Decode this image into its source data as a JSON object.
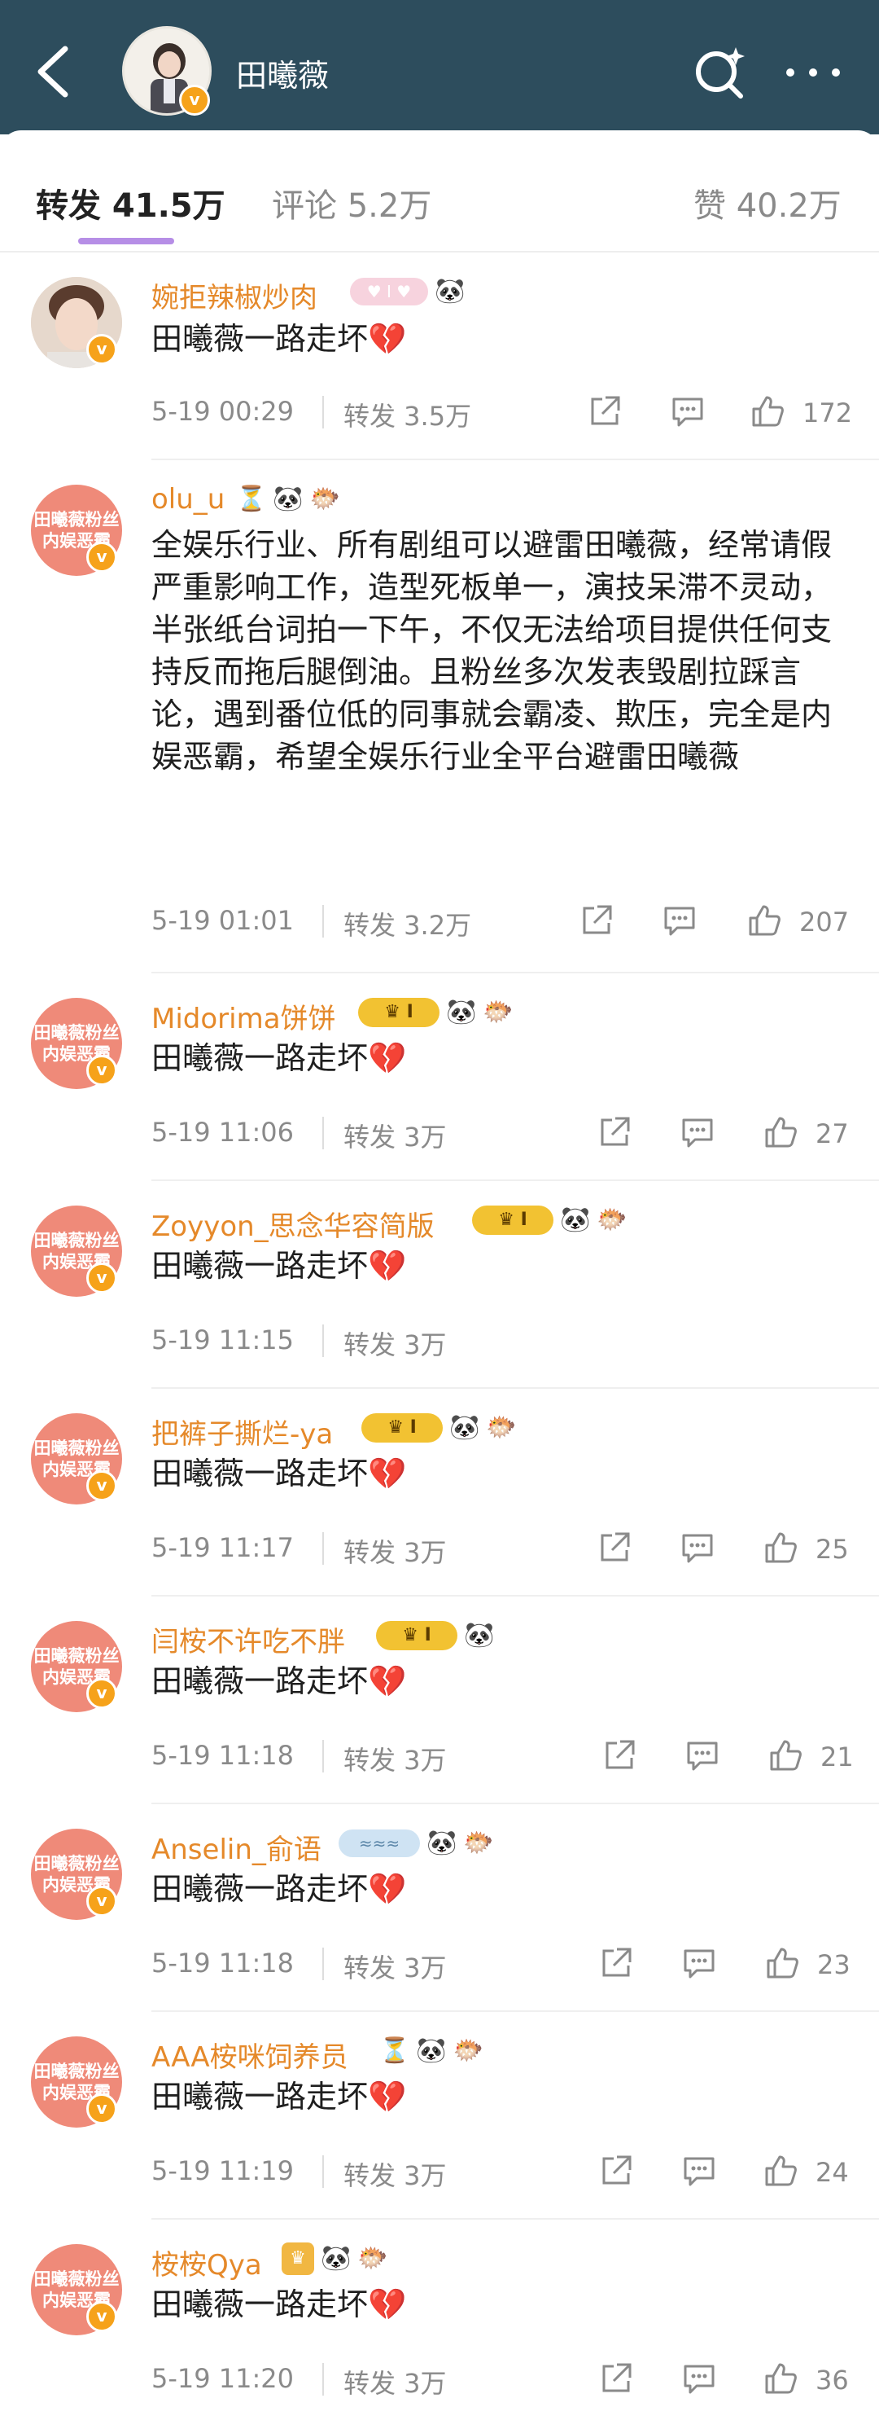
{
  "header": {
    "title": "田曦薇"
  },
  "tabs": [
    {
      "label": "转发 41.5万"
    },
    {
      "label": "评论 5.2万"
    },
    {
      "label": "赞 40.2万"
    }
  ],
  "comments": [
    {
      "name": "婉拒辣椒炒肉",
      "text": "田曦薇一路走坏💔",
      "time": "5-19 00:29",
      "repost": "转发 3.5万",
      "likes": "172"
    },
    {
      "name": "olu_u",
      "text": "全娱乐行业、所有剧组可以避雷田曦薇，经常请假严重影响工作，造型死板单一，演技呆滞不灵动，半张纸台词拍一下午，不仅无法给项目提供任何支持反而拖后腿倒油。且粉丝多次发表毁剧拉踩言论，遇到番位低的同事就会霸凌、欺压，完全是内娱恶霸，希望全娱乐行业全平台避雷田曦薇",
      "time": "5-19 01:01",
      "repost": "转发 3.2万",
      "likes": "207"
    },
    {
      "name": "Midorima饼饼",
      "text": "田曦薇一路走坏💔",
      "time": "5-19 11:06",
      "repost": "转发 3万",
      "likes": "27"
    },
    {
      "name": "Zoyyon_思念华容简版",
      "text": "田曦薇一路走坏💔",
      "time": "5-19 11:15",
      "repost": "转发 3万",
      "likes": ""
    },
    {
      "name": "把裤子撕烂-ya",
      "text": "田曦薇一路走坏💔",
      "time": "5-19 11:17",
      "repost": "转发 3万",
      "likes": "25"
    },
    {
      "name": "闫桉不许吃不胖",
      "text": "田曦薇一路走坏💔",
      "time": "5-19 11:18",
      "repost": "转发 3万",
      "likes": "21"
    },
    {
      "name": "Anselin_俞语",
      "text": "田曦薇一路走坏💔",
      "time": "5-19 11:18",
      "repost": "转发 3万",
      "likes": "23"
    },
    {
      "name": "AAA桉咪饲养员",
      "text": "田曦薇一路走坏💔",
      "time": "5-19 11:19",
      "repost": "转发 3万",
      "likes": "24"
    },
    {
      "name": "桉桉Qya",
      "text": "田曦薇一路走坏💔",
      "time": "5-19 11:20",
      "repost": "转发 3万",
      "likes": "36"
    }
  ],
  "fan_avatar_text": [
    "田曦薇粉丝",
    "内娱恶霸"
  ],
  "verified_mark": "v",
  "icons": {
    "back": "chevron-left-icon",
    "search": "search-sparkle-icon",
    "more": "more-dots-icon",
    "share": "share-icon",
    "comment": "comment-icon",
    "like": "thumbs-up-icon"
  },
  "colors": {
    "header_bg": "#2d4d5d",
    "username": "#e5892a",
    "tab_underline": "#b68ee6",
    "fan_avatar": "#ef8a79"
  }
}
